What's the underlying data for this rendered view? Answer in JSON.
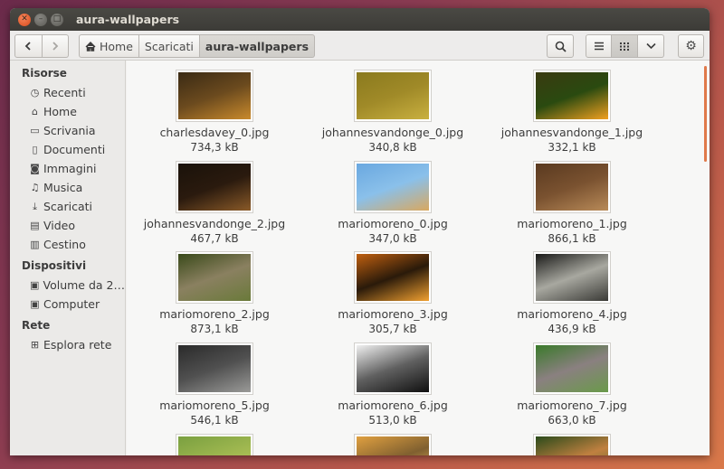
{
  "window": {
    "title": "aura-wallpapers"
  },
  "toolbar": {
    "back_icon": "chevron-left-icon",
    "forward_icon": "chevron-right-icon",
    "breadcrumbs": [
      {
        "label": "Home",
        "icon": "home-icon"
      },
      {
        "label": "Scaricati"
      },
      {
        "label": "aura-wallpapers"
      }
    ]
  },
  "sidebar": {
    "sections": [
      {
        "title": "Risorse",
        "items": [
          {
            "label": "Recenti",
            "icon": "clock-icon"
          },
          {
            "label": "Home",
            "icon": "home-icon"
          },
          {
            "label": "Scrivania",
            "icon": "folder-icon"
          },
          {
            "label": "Documenti",
            "icon": "document-icon"
          },
          {
            "label": "Immagini",
            "icon": "camera-icon"
          },
          {
            "label": "Musica",
            "icon": "music-icon"
          },
          {
            "label": "Scaricati",
            "icon": "download-icon"
          },
          {
            "label": "Video",
            "icon": "film-icon"
          },
          {
            "label": "Cestino",
            "icon": "trash-icon"
          }
        ]
      },
      {
        "title": "Dispositivi",
        "items": [
          {
            "label": "Volume da 2…",
            "icon": "drive-icon"
          },
          {
            "label": "Computer",
            "icon": "drive-icon"
          }
        ]
      },
      {
        "title": "Rete",
        "items": [
          {
            "label": "Esplora rete",
            "icon": "network-icon"
          }
        ]
      }
    ]
  },
  "files": [
    {
      "name": "charlesdavey_0.jpg",
      "size": "734,3 kB",
      "colors": [
        "#3a2a14",
        "#c98a2c",
        "#6b4a1e"
      ]
    },
    {
      "name": "johannesvandonge_0.jpg",
      "size": "340,8 kB",
      "colors": [
        "#8a7a1e",
        "#c9b040",
        "#a08a28"
      ]
    },
    {
      "name": "johannesvandonge_1.jpg",
      "size": "332,1 kB",
      "colors": [
        "#3a3a10",
        "#f0a020",
        "#2a4a10"
      ]
    },
    {
      "name": "johannesvandonge_2.jpg",
      "size": "467,7 kB",
      "colors": [
        "#1a120a",
        "#8a5a28",
        "#2a1a0e"
      ]
    },
    {
      "name": "mariomoreno_0.jpg",
      "size": "347,0 kB",
      "colors": [
        "#6aa8e0",
        "#d9a860",
        "#8ac0ea"
      ]
    },
    {
      "name": "mariomoreno_1.jpg",
      "size": "866,1 kB",
      "colors": [
        "#5a3a20",
        "#b88a58",
        "#7a5230"
      ]
    },
    {
      "name": "mariomoreno_2.jpg",
      "size": "873,1 kB",
      "colors": [
        "#3a4a1a",
        "#6a7a3a",
        "#8a8060"
      ]
    },
    {
      "name": "mariomoreno_3.jpg",
      "size": "305,7 kB",
      "colors": [
        "#c06010",
        "#f0a030",
        "#2a1a0a"
      ]
    },
    {
      "name": "mariomoreno_4.jpg",
      "size": "436,9 kB",
      "colors": [
        "#1a1a18",
        "#3a3a36",
        "#a8a8a0"
      ]
    },
    {
      "name": "mariomoreno_5.jpg",
      "size": "546,1 kB",
      "colors": [
        "#2a2a2a",
        "#9a9a98",
        "#505050"
      ]
    },
    {
      "name": "mariomoreno_6.jpg",
      "size": "513,0 kB",
      "colors": [
        "#f0f0f0",
        "#101010",
        "#606060"
      ]
    },
    {
      "name": "mariomoreno_7.jpg",
      "size": "663,0 kB",
      "colors": [
        "#3a7a2a",
        "#6a9a4a",
        "#8a8080"
      ]
    },
    {
      "name": "",
      "size": "",
      "colors": [
        "#7aa040",
        "#c0d060",
        "#a0b850"
      ]
    },
    {
      "name": "",
      "size": "",
      "colors": [
        "#e0a040",
        "#f0c060",
        "#806030"
      ]
    },
    {
      "name": "",
      "size": "",
      "colors": [
        "#2a4a1a",
        "#4a6a2a",
        "#c08040"
      ]
    }
  ]
}
